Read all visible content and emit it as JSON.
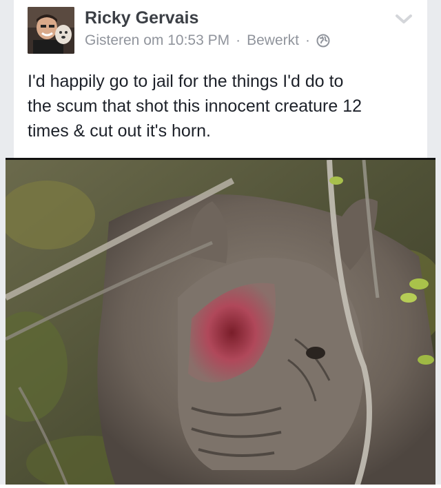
{
  "post": {
    "author": "Ricky Gervais",
    "timestamp": "Gisteren om 10:53 PM",
    "separator": "·",
    "edited_label": "Bewerkt",
    "audience_icon": "globe-icon",
    "menu_icon": "chevron-down-icon",
    "text": "I'd happily go to jail for the things I'd do to\nthe scum that shot this innocent creature 12\ntimes & cut out it's horn."
  },
  "colors": {
    "page_bg": "#e9ebee",
    "card_bg": "#ffffff",
    "author": "#3b3f45",
    "meta": "#90949c",
    "text": "#1d2129"
  }
}
